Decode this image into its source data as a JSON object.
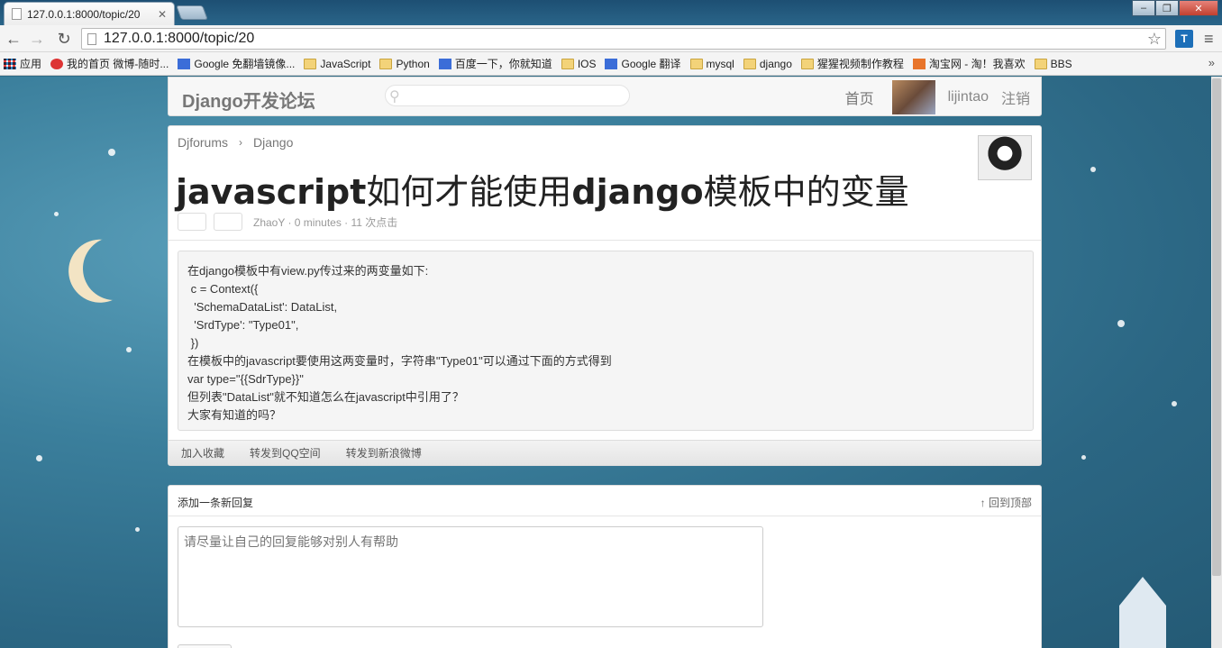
{
  "browser": {
    "tab_title": "127.0.0.1:8000/topic/20",
    "url": "127.0.0.1:8000/topic/20",
    "window_min": "–",
    "window_max": "❐",
    "window_close": "✕",
    "back_icon": "←",
    "forward_icon": "→",
    "reload_icon": "↻",
    "star_icon": "☆",
    "menu_icon": "≡",
    "bookmarks": [
      {
        "label": "应用",
        "icon": "apps"
      },
      {
        "label": "我的首页 微博-随时...",
        "icon": "round"
      },
      {
        "label": "Google 免翻墙镜像...",
        "icon": "sq-blue"
      },
      {
        "label": "JavaScript",
        "icon": "folder"
      },
      {
        "label": "Python",
        "icon": "folder"
      },
      {
        "label": "百度一下，你就知道",
        "icon": "sq-blue"
      },
      {
        "label": "IOS",
        "icon": "folder"
      },
      {
        "label": "Google 翻译",
        "icon": "sq-blue"
      },
      {
        "label": "mysql",
        "icon": "folder"
      },
      {
        "label": "django",
        "icon": "folder"
      },
      {
        "label": "猩猩视频制作教程",
        "icon": "folder"
      },
      {
        "label": "淘宝网 - 淘！我喜欢",
        "icon": "sq-orange"
      },
      {
        "label": "BBS",
        "icon": "folder"
      }
    ],
    "bookmarks_more": "»"
  },
  "header": {
    "logo": "Django开发论坛",
    "search_placeholder": "",
    "home": "首页",
    "username": "lijintao",
    "logout": "注销"
  },
  "topic": {
    "crumb_home": "Djforums",
    "crumb_sep": "›",
    "crumb_node": "Django",
    "title_parts": [
      {
        "text": "javascript",
        "bold": true
      },
      {
        "text": "如何才能使用",
        "bold": false
      },
      {
        "text": "django",
        "bold": true
      },
      {
        "text": "模板中的变量",
        "bold": false
      }
    ],
    "meta": "ZhaoY · 0 minutes · 11 次点击",
    "body": "在django模板中有view.py传过来的两变量如下:\n c = Context({\n  'SchemaDataList': DataList,\n  'SrdType': \"Type01\",\n })\n在模板中的javascript要使用这两变量时，字符串\"Type01\"可以通过下面的方式得到\nvar type=\"{{SdrType}}\"\n但列表\"DataList\"就不知道怎么在javascript中引用了？\n大家有知道的吗？",
    "actions": [
      "加入收藏",
      "转发到QQ空间",
      "转发到新浪微博"
    ]
  },
  "reply": {
    "title": "添加一条新回复",
    "back_to_top": "↑ 回到顶部",
    "placeholder": "请尽量让自己的回复能够对别人有帮助"
  }
}
